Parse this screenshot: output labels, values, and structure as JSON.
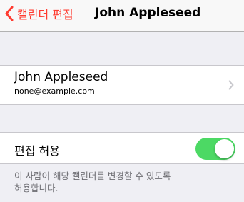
{
  "nav": {
    "back_label": "캘린더 편집",
    "title": "John Appleseed"
  },
  "contact": {
    "name": "John Appleseed",
    "email": "none@example.com"
  },
  "permission": {
    "label": "편집 허용",
    "enabled": true,
    "footer_lines": [
      "이 사람이 해당 캘린더를 변경할 수 있도록",
      "허용합니다."
    ]
  },
  "colors": {
    "accent": "#ff3b30",
    "toggle_on": "#4cd964",
    "background": "#efeff4",
    "footer_text": "#6d6d72"
  },
  "icons": {
    "back": "chevron-left-icon",
    "disclosure": "chevron-right-icon"
  }
}
